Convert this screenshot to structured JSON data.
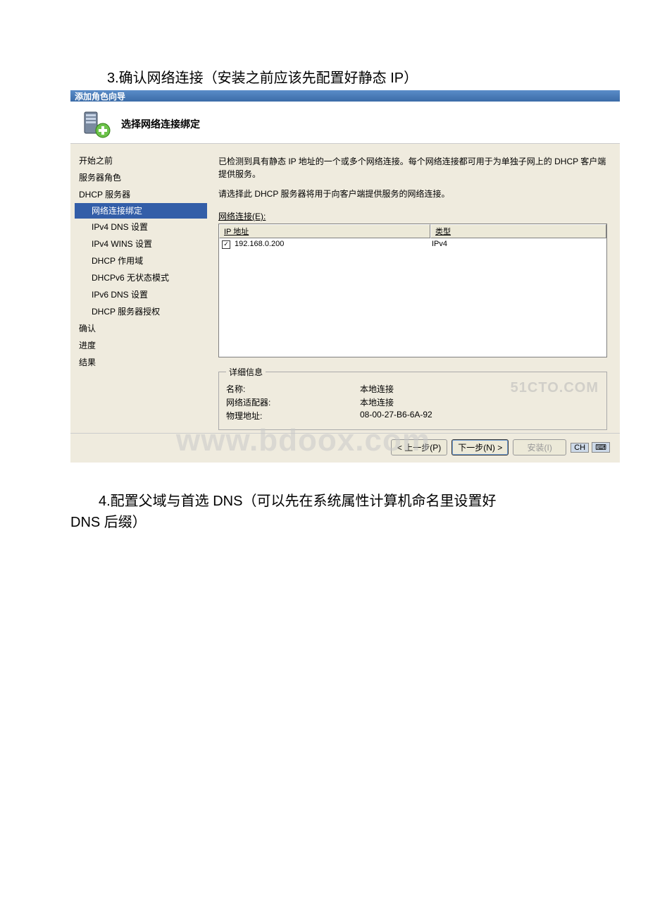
{
  "doc": {
    "step3": "3.确认网络连接（安装之前应该先配置好静态 IP）",
    "step4_line1": "　　4.配置父域与首选 DNS（可以先在系统属性计算机命名里设置好",
    "step4_line2": "DNS 后缀）"
  },
  "wizard": {
    "titlebar": "添加角色向导",
    "heading": "选择网络连接绑定",
    "sidebar": {
      "items": [
        "开始之前",
        "服务器角色",
        "DHCP 服务器"
      ],
      "selected": "网络连接绑定",
      "subs": [
        "IPv4 DNS 设置",
        "IPv4 WINS 设置",
        "DHCP 作用域",
        "DHCPv6 无状态模式",
        "IPv6 DNS 设置",
        "DHCP 服务器授权"
      ],
      "tail": [
        "确认",
        "进度",
        "结果"
      ]
    },
    "main": {
      "desc1": "已检测到具有静态 IP 地址的一个或多个网络连接。每个网络连接都可用于为单独子网上的 DHCP 客户端提供服务。",
      "desc2": "请选择此 DHCP 服务器将用于向客户端提供服务的网络连接。",
      "network_label": "网络连接(E):",
      "col_ip": "IP 地址",
      "col_type": "类型",
      "row_ip": "192.168.0.200",
      "row_type": "IPv4",
      "details_legend": "详细信息",
      "detail_name_label": "名称:",
      "detail_name_value": "本地连接",
      "detail_adapter_label": "网络适配器:",
      "detail_adapter_value": "本地连接",
      "detail_mac_label": "物理地址:",
      "detail_mac_value": "08-00-27-B6-6A-92"
    },
    "buttons": {
      "prev": "< 上一步(P)",
      "next": "下一步(N) >",
      "install": "安装(I)",
      "lang": "CH"
    }
  },
  "watermarks": {
    "site1": "51CTO.COM",
    "site2": "WWW.bdoox.com"
  }
}
